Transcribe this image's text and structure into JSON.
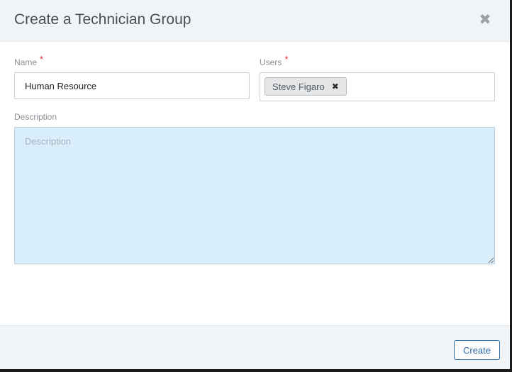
{
  "modal": {
    "title": "Create a Technician Group",
    "close_icon": "close-icon"
  },
  "form": {
    "name": {
      "label": "Name",
      "required_marker": "*",
      "value": "Human Resource"
    },
    "users": {
      "label": "Users",
      "required_marker": "*",
      "selected": [
        {
          "label": "Steve Figaro",
          "remove_icon": "remove-x-icon"
        }
      ]
    },
    "description": {
      "label": "Description",
      "placeholder": "Description",
      "value": ""
    }
  },
  "footer": {
    "create_label": "Create"
  },
  "colors": {
    "header_bg": "#f1f4f7",
    "textarea_bg": "#d8eefb",
    "required": "#e0332b",
    "primary_outline": "#2f6fa8"
  }
}
